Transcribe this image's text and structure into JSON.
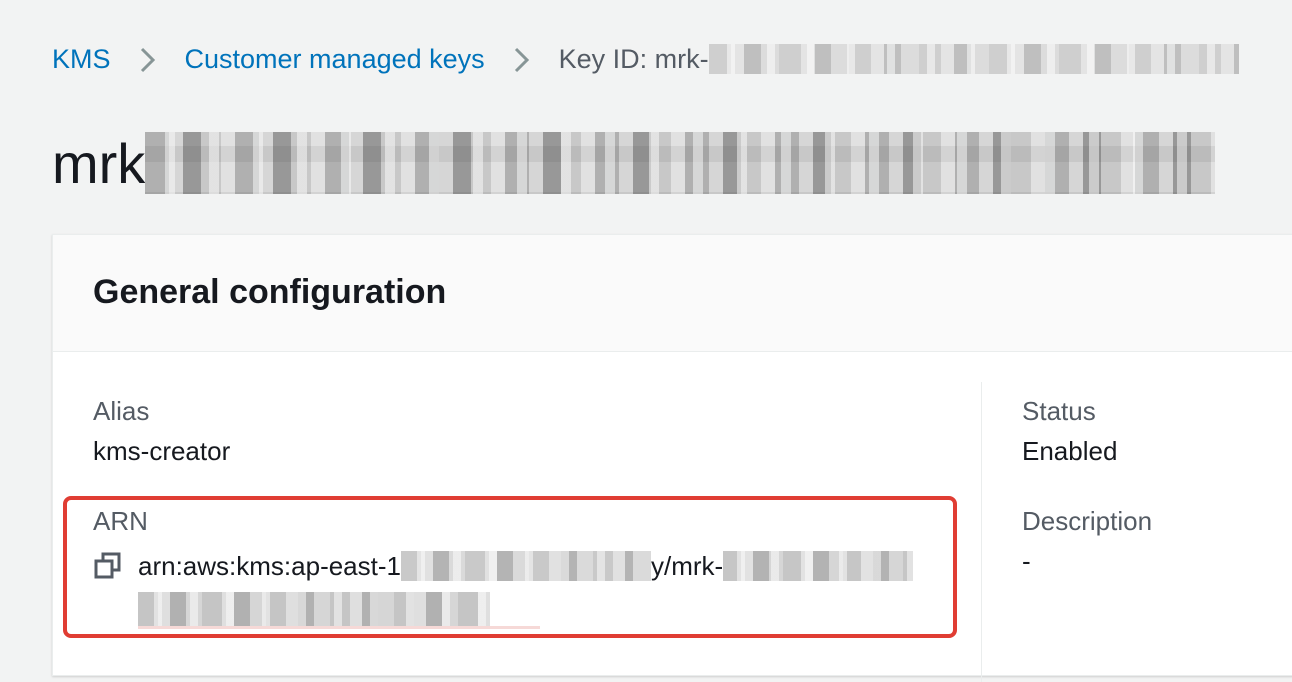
{
  "breadcrumb": {
    "items": [
      {
        "label": "KMS"
      },
      {
        "label": "Customer managed keys"
      }
    ],
    "current": "Key ID: mrk-"
  },
  "page": {
    "title_prefix": "mrk"
  },
  "general_configuration": {
    "heading": "General configuration",
    "alias": {
      "label": "Alias",
      "value": "kms-creator"
    },
    "status": {
      "label": "Status",
      "value": "Enabled"
    },
    "arn": {
      "label": "ARN",
      "value_start": "arn:aws:kms:ap-east-1",
      "value_mid": "y/mrk-"
    },
    "description": {
      "label": "Description",
      "value": "-"
    }
  },
  "icons": {
    "breadcrumb_separator": "chevron-right-icon",
    "copy": "copy-icon"
  },
  "colors": {
    "link": "#0073bb",
    "highlight": "#e03d33",
    "background": "#f2f3f3"
  }
}
